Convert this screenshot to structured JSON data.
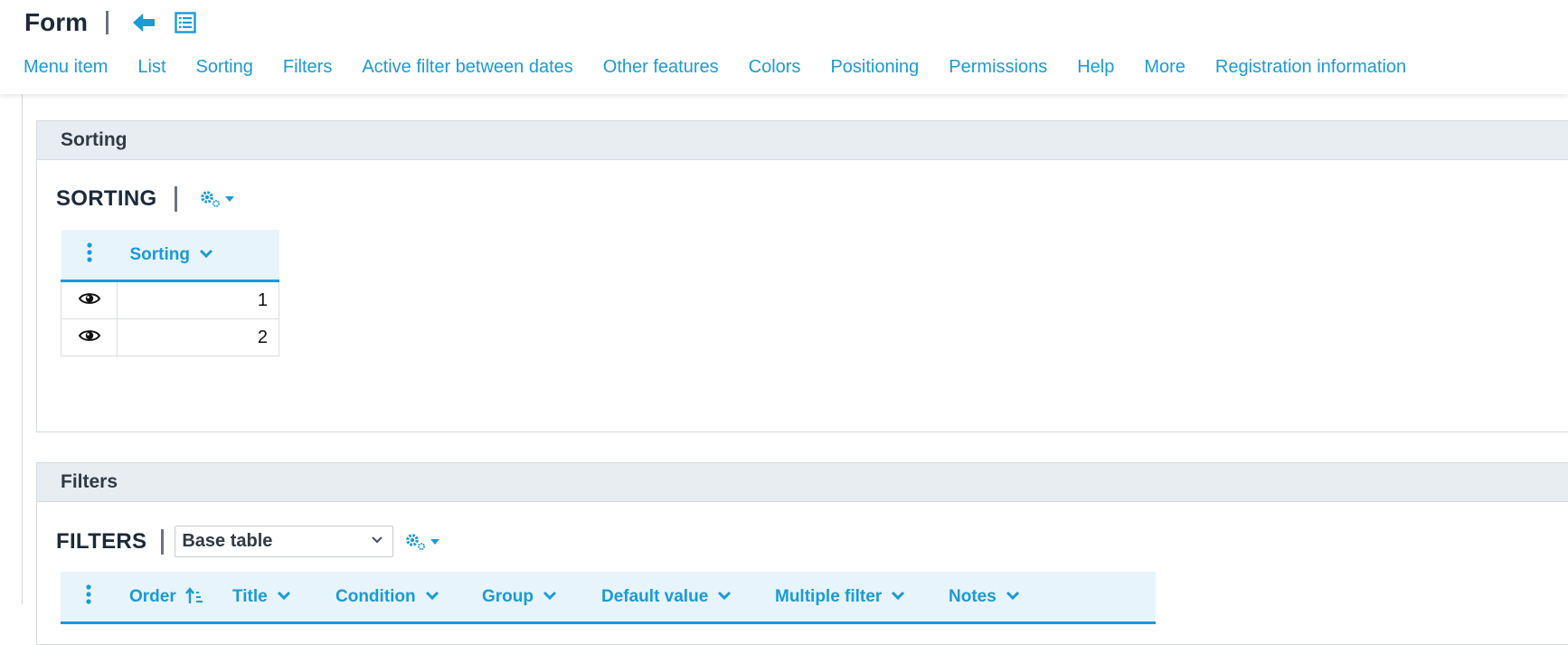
{
  "header": {
    "title": "Form",
    "back_icon": "arrow-left-icon",
    "list_icon": "list-icon",
    "accent_color": "#1a9ad8"
  },
  "nav": {
    "items": [
      "Menu item",
      "List",
      "Sorting",
      "Filters",
      "Active filter between dates",
      "Other features",
      "Colors",
      "Positioning",
      "Permissions",
      "Help",
      "More",
      "Registration information"
    ]
  },
  "sorting_panel": {
    "header": "Sorting",
    "section_title": "SORTING",
    "gear_icon": "gear-icon",
    "table": {
      "columns": [
        "Sorting"
      ],
      "rows": [
        {
          "icon": "eye-icon",
          "value": "1"
        },
        {
          "icon": "eye-icon",
          "value": "2"
        }
      ]
    }
  },
  "filters_panel": {
    "header": "Filters",
    "section_title": "FILTERS",
    "select_value": "Base table",
    "gear_icon": "gear-icon",
    "table": {
      "columns": [
        "Order",
        "Title",
        "Condition",
        "Group",
        "Default value",
        "Multiple filter",
        "Notes"
      ]
    }
  }
}
